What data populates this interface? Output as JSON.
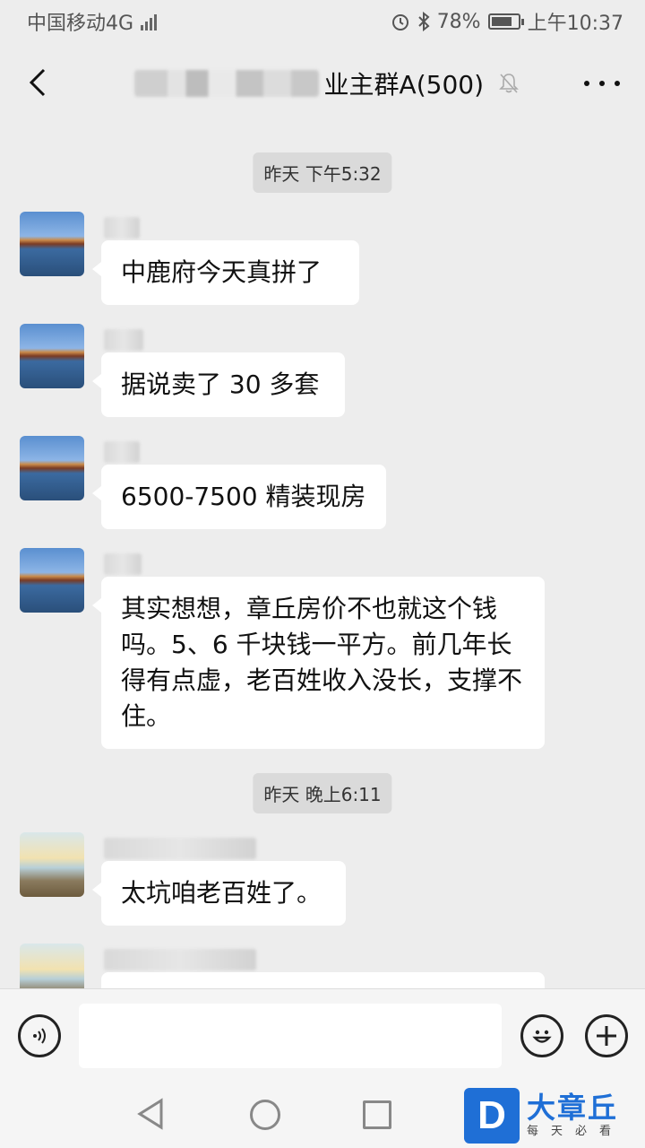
{
  "status_bar": {
    "carrier": "中国移动4G",
    "network_badge": "4G",
    "battery": "78%",
    "battery_level": 0.78,
    "time": "上午10:37"
  },
  "title_bar": {
    "title": "业主群A(500)",
    "back_icon": "chevron-left-icon",
    "mute_icon": "bell-off-icon",
    "more_icon": "more-dots-icon"
  },
  "chat": {
    "timestamps": [
      "昨天 下午5:32",
      "昨天 晚上6:11"
    ],
    "messages": [
      {
        "avatar": "palace",
        "text": "中鹿府今天真拼了"
      },
      {
        "avatar": "palace",
        "text": "据说卖了 30 多套"
      },
      {
        "avatar": "palace",
        "text": "6500-7500 精装现房"
      },
      {
        "avatar": "palace",
        "text": "其实想想，章丘房价不也就这个钱吗。5、6 千块钱一平方。前几年长得有点虚，老百姓收入没长，支撑不住。"
      },
      {
        "avatar": "beach",
        "text": "太坑咱老百姓了。"
      },
      {
        "avatar": "beach",
        "text": ""
      }
    ]
  },
  "input_bar": {
    "voice_icon": "voice-icon",
    "emoji_icon": "emoji-icon",
    "plus_icon": "plus-icon",
    "placeholder": ""
  },
  "nav_bar": {
    "back_icon": "triangle-back-icon",
    "home_icon": "circle-home-icon",
    "recent_icon": "square-recent-icon"
  },
  "watermark": {
    "logo_letter": "D",
    "name": "大章丘",
    "slogan": "每天必看"
  },
  "colors": {
    "background": "#ededed",
    "bubble": "#ffffff",
    "brand_blue": "#1f6fd6"
  }
}
